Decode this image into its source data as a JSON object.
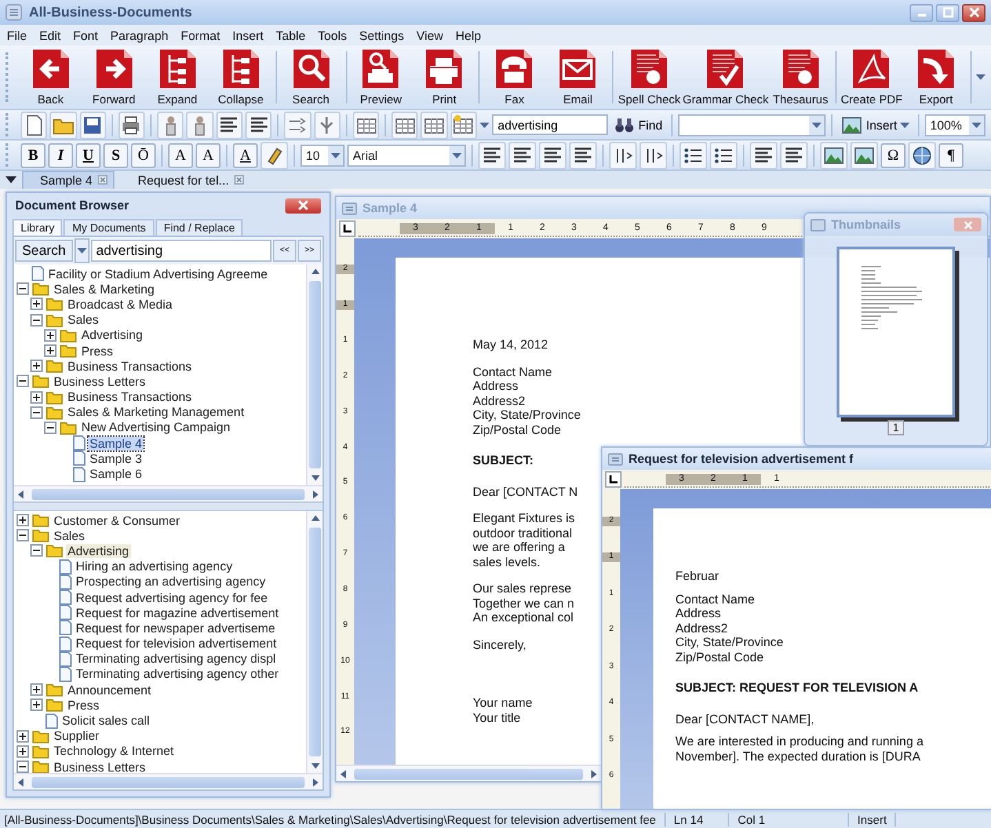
{
  "window": {
    "title": "All-Business-Documents"
  },
  "menu": [
    "File",
    "Edit",
    "Font",
    "Paragraph",
    "Format",
    "Insert",
    "Table",
    "Tools",
    "Settings",
    "View",
    "Help"
  ],
  "main_toolbar": {
    "groups": [
      [
        {
          "kind": "back",
          "label": "Back"
        },
        {
          "kind": "forward",
          "label": "Forward"
        },
        {
          "kind": "expand",
          "label": "Expand"
        },
        {
          "kind": "collapse",
          "label": "Collapse"
        }
      ],
      [
        {
          "kind": "search",
          "label": "Search"
        }
      ],
      [
        {
          "kind": "preview",
          "label": "Preview"
        },
        {
          "kind": "print",
          "label": "Print"
        }
      ],
      [
        {
          "kind": "fax",
          "label": "Fax"
        },
        {
          "kind": "email",
          "label": "Email"
        }
      ],
      [
        {
          "kind": "spell",
          "label": "Spell Check"
        },
        {
          "kind": "grammar",
          "label": "Grammar Check"
        },
        {
          "kind": "thesaurus",
          "label": "Thesaurus"
        }
      ],
      [
        {
          "kind": "pdf",
          "label": "Create PDF"
        },
        {
          "kind": "export",
          "label": "Export"
        }
      ]
    ]
  },
  "edit_toolbar": {
    "search_value": "advertising",
    "find_label": "Find",
    "insert_label": "Insert",
    "zoom_value": "100%"
  },
  "format_toolbar": {
    "style_buttons": [
      "B",
      "I",
      "U",
      "S",
      "Ō"
    ],
    "script_buttons": [
      "A",
      "A"
    ],
    "color_button": "A",
    "font_size": "10",
    "font_name": "Arial",
    "symbol_button": "Ω",
    "pilcrow_button": "¶"
  },
  "doc_tabs": [
    {
      "label": "Sample 4",
      "selected": true
    },
    {
      "label": "Request for tel...",
      "selected": false
    }
  ],
  "browser": {
    "title": "Document Browser",
    "tabs": [
      {
        "label": "Library",
        "selected": true
      },
      {
        "label": "My Documents",
        "selected": false
      },
      {
        "label": "Find / Replace",
        "selected": false
      }
    ],
    "search_label": "Search",
    "search_value": "advertising",
    "prev_label": "<<",
    "next_label": ">>",
    "top_tree": {
      "focused": true,
      "items": [
        {
          "kind": "doc",
          "label": "Facility or Stadium Advertising Agreeme",
          "selected": false
        },
        {
          "kind": "folder",
          "label": "Sales & Marketing",
          "expanded": true,
          "selected": false,
          "children": [
            {
              "kind": "folder",
              "label": "Broadcast & Media",
              "expanded": false,
              "selected": false
            },
            {
              "kind": "folder",
              "label": "Sales",
              "expanded": true,
              "selected": false,
              "children": [
                {
                  "kind": "folder",
                  "label": "Advertising",
                  "expanded": false,
                  "selected": false
                },
                {
                  "kind": "folder",
                  "label": "Press",
                  "expanded": false,
                  "selected": false
                }
              ]
            },
            {
              "kind": "folder",
              "label": "Business Transactions",
              "expanded": false,
              "selected": false
            }
          ]
        },
        {
          "kind": "folder",
          "label": "Business Letters",
          "expanded": true,
          "selected": false,
          "children": [
            {
              "kind": "folder",
              "label": "Business Transactions",
              "expanded": false,
              "selected": false
            },
            {
              "kind": "folder",
              "label": "Sales & Marketing Management",
              "expanded": true,
              "selected": false,
              "children": [
                {
                  "kind": "folder",
                  "label": "New Advertising Campaign",
                  "expanded": true,
                  "selected": false,
                  "children": [
                    {
                      "kind": "doc",
                      "label": "Sample 4",
                      "selected": true
                    },
                    {
                      "kind": "doc",
                      "label": "Sample 3",
                      "selected": false
                    },
                    {
                      "kind": "doc",
                      "label": "Sample 6",
                      "selected": false
                    }
                  ]
                }
              ]
            }
          ]
        }
      ]
    },
    "bottom_tree": {
      "focused": false,
      "items": [
        {
          "kind": "folder",
          "label": "Customer & Consumer",
          "expanded": false,
          "selected": false
        },
        {
          "kind": "folder",
          "label": "Sales",
          "expanded": true,
          "selected": false,
          "children": [
            {
              "kind": "folder",
              "label": "Advertising",
              "expanded": true,
              "selected": true,
              "children": [
                {
                  "kind": "doc",
                  "label": "Hiring an advertising agency",
                  "selected": false
                },
                {
                  "kind": "doc",
                  "label": "Prospecting an advertising agency",
                  "selected": false
                },
                {
                  "kind": "doc",
                  "label": "Request advertising agency for fee",
                  "selected": false
                },
                {
                  "kind": "doc",
                  "label": "Request for magazine advertisement",
                  "selected": false
                },
                {
                  "kind": "doc",
                  "label": "Request for newspaper advertiseme",
                  "selected": false
                },
                {
                  "kind": "doc",
                  "label": "Request for television advertisement",
                  "selected": false
                },
                {
                  "kind": "doc",
                  "label": "Terminating advertising agency displ",
                  "selected": false
                },
                {
                  "kind": "doc",
                  "label": "Terminating advertising agency other",
                  "selected": false
                }
              ]
            },
            {
              "kind": "folder",
              "label": "Announcement",
              "expanded": false,
              "selected": false
            },
            {
              "kind": "folder",
              "label": "Press",
              "expanded": false,
              "selected": false
            },
            {
              "kind": "doc",
              "label": "Solicit sales call",
              "selected": false
            }
          ]
        },
        {
          "kind": "folder",
          "label": "Supplier",
          "expanded": false,
          "selected": false
        },
        {
          "kind": "folder",
          "label": "Technology & Internet",
          "expanded": false,
          "selected": false
        },
        {
          "kind": "folder",
          "label": "Business Letters",
          "expanded": true,
          "selected": false
        }
      ]
    }
  },
  "sample_window": {
    "title": "Sample 4",
    "ruler_labels": [
      "3",
      "2",
      "1",
      "1",
      "2",
      "3",
      "4",
      "5",
      "6",
      "7",
      "8",
      "9"
    ],
    "vruler_labels": [
      "2",
      "1",
      "1",
      "2",
      "3",
      "4",
      "5",
      "6",
      "7",
      "8",
      "9",
      "10",
      "11",
      "12"
    ],
    "paragraphs": [
      {
        "kind": "plain",
        "lines": [
          "May 14, 2012"
        ]
      },
      {
        "kind": "plain",
        "lines": [
          "Contact Name",
          "Address",
          "Address2",
          "City, State/Province",
          "Zip/Postal Code"
        ]
      },
      {
        "kind": "heading",
        "lines": [
          "SUBJECT:"
        ]
      },
      {
        "kind": "plain",
        "lines": [
          "Dear [CONTACT N"
        ]
      },
      {
        "kind": "plain",
        "lines": [
          "Elegant Fixtures is",
          "outdoor traditional",
          "we are offering a",
          "sales levels."
        ]
      },
      {
        "kind": "plain",
        "lines": [
          "Our sales represe",
          "Together we can n",
          "An exceptional col"
        ]
      },
      {
        "kind": "plain",
        "lines": [
          "Sincerely,"
        ]
      },
      {
        "kind": "signature",
        "lines": [
          "Your name",
          "Your title"
        ]
      }
    ]
  },
  "request_window": {
    "title": "Request for television advertisement f",
    "ruler_labels": [
      "3",
      "2",
      "1",
      "1"
    ],
    "vruler_labels": [
      "2",
      "1",
      "1",
      "2",
      "3",
      "4",
      "5",
      "6"
    ],
    "paragraphs": [
      {
        "kind": "plain",
        "lines": [
          "Februar"
        ]
      },
      {
        "kind": "plain",
        "lines": [
          "Contact Name",
          "Address",
          "Address2",
          "City, State/Province",
          "Zip/Postal Code"
        ]
      },
      {
        "kind": "heading",
        "lines": [
          "SUBJECT: REQUEST FOR TELEVISION A"
        ]
      },
      {
        "kind": "plain",
        "lines": [
          "Dear [CONTACT NAME],"
        ]
      },
      {
        "kind": "plain",
        "lines": [
          "We are interested in producing and running a",
          "November].  The expected duration is [DURA"
        ]
      }
    ]
  },
  "thumbnails": {
    "title": "Thumbnails",
    "page_number": "1"
  },
  "status_bar": [
    "[All-Business-Documents]\\Business Documents\\Sales & Marketing\\Sales\\Advertising\\Request for television advertisement fee",
    "Ln 14",
    "Col 1",
    "Insert"
  ]
}
